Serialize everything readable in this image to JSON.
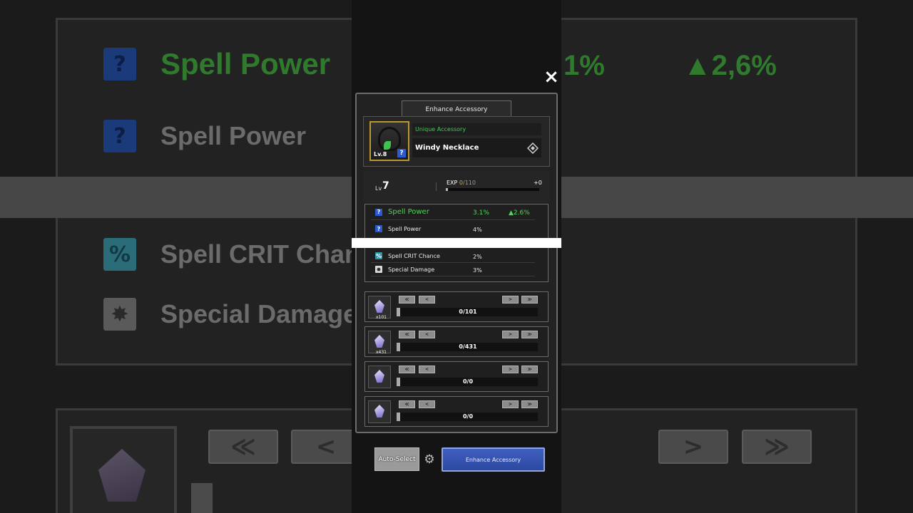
{
  "background": {
    "rows": [
      {
        "icon": "?",
        "label": "Spell Power"
      },
      {
        "icon": "?",
        "label": "Spell Power"
      },
      {
        "icon": "%",
        "label": "Spell CRIT Chanc"
      },
      {
        "icon": "✸",
        "label": "Special Damage"
      }
    ],
    "value_partial": "1%",
    "value_up": "▲2,6%",
    "buttons": [
      "≪",
      "<",
      ">",
      "≫"
    ]
  },
  "dialog": {
    "title": "Enhance Accessory",
    "close_icon": "×"
  },
  "item": {
    "rarity": "Unique Accessory",
    "name": "Windy Necklace",
    "thumb_level": "Lv.8",
    "thumb_badge": "?"
  },
  "level": {
    "label": "Lv",
    "value": "7",
    "exp_label": "EXP",
    "exp_current": "0",
    "exp_max": "/110",
    "exp_gain": "+0",
    "exp_progress": 0.02
  },
  "stats": [
    {
      "icon": "?",
      "label": "Spell Power",
      "value": "3.1%",
      "up": "▲2.6%"
    },
    {
      "icon": "?",
      "label": "Spell Power",
      "value": "4%"
    },
    {
      "icon": "%",
      "label": "Spell CRIT Chance",
      "value": "2%"
    },
    {
      "icon": "✸",
      "label": "Special Damage",
      "value": "3%"
    }
  ],
  "materials": [
    {
      "count": "x101",
      "value": "0/101"
    },
    {
      "count": "x431",
      "value": "0/431"
    },
    {
      "count": "",
      "value": "0/0"
    },
    {
      "count": "",
      "value": "0/0"
    }
  ],
  "stepper": {
    "first": "≪",
    "prev": "<",
    "next": ">",
    "last": "≫"
  },
  "footer": {
    "auto_select": "Auto-Select",
    "enhance": "Enhance Accessory"
  },
  "colors": {
    "accent_green": "#4fd85a",
    "enhance_blue": "#2d48a0",
    "rarity_gold": "#b8982f"
  }
}
